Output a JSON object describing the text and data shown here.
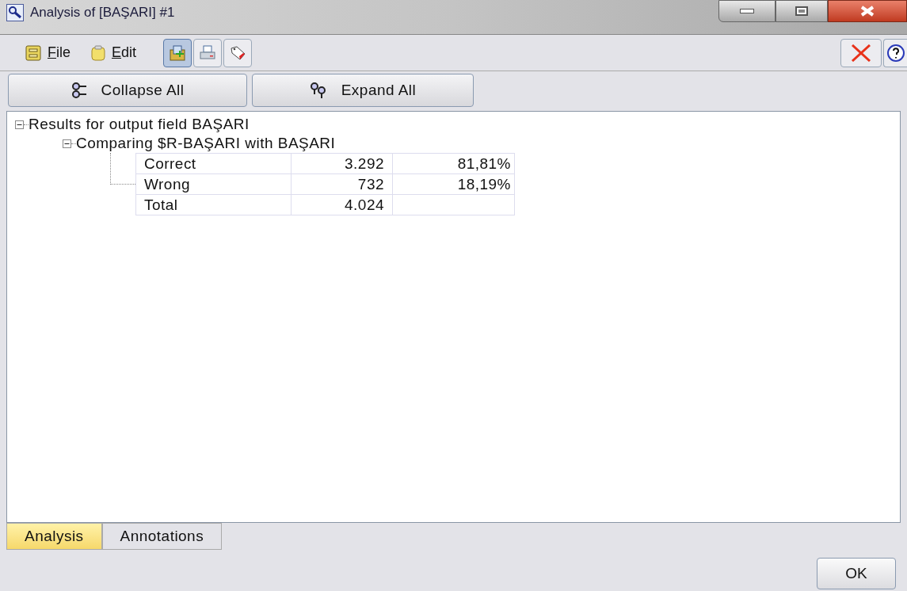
{
  "window": {
    "title": "Analysis of [BAŞARI] #1"
  },
  "menu": [
    {
      "label": "File",
      "kind": "file"
    },
    {
      "label": "Edit",
      "kind": "edit"
    }
  ],
  "toolbar": [
    {
      "kind": "add",
      "selected": true
    },
    {
      "kind": "print",
      "selected": false
    },
    {
      "kind": "tag",
      "selected": false
    }
  ],
  "actions": [
    {
      "label": "Collapse All",
      "kind": "collapse"
    },
    {
      "label": "Expand All",
      "kind": "expand"
    }
  ],
  "tree": [
    {
      "label": "Results for output field BAŞARI",
      "expanded": true,
      "children": [
        {
          "label": "Comparing $R-BAŞARI with BAŞARI",
          "expanded": true,
          "table": [
            [
              "Correct",
              "3.292",
              "81,81%"
            ],
            [
              "Wrong",
              "732",
              "18,19%"
            ],
            [
              "Total",
              "4.024"
            ]
          ]
        }
      ]
    }
  ],
  "tabs": [
    {
      "label": "Analysis",
      "selected": true
    },
    {
      "label": "Annotations",
      "selected": false
    }
  ],
  "ok_button": "OK"
}
